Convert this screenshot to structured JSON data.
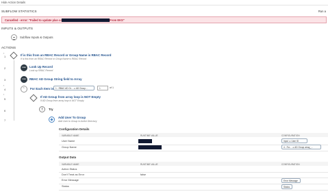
{
  "topbar": {
    "hide_link": "Hide Action Details"
  },
  "header": {
    "title": "SUBFLOW STATISTICS",
    "run_label": "Run a"
  },
  "alert": {
    "message_prefix": "Cancelled - error: \"Failed to update plan context: ",
    "message_suffix": " From EKS\""
  },
  "inputs_outputs": {
    "title": "INPUTS & OUTPUTS",
    "subflow_label": "Subflow Inputs & Outputs"
  },
  "actions": {
    "title": "ACTIONS",
    "steps": [
      {
        "num": "1",
        "title": "If is this from an RBAC Record or Group Name is RBAC Record",
        "subtitle": "If is this from an RBAC Record or Group Name is RBAC Record"
      },
      {
        "num": "2",
        "title": "Look Up Record",
        "subtitle": "Look up RBAC Record"
      },
      {
        "num": "3",
        "title": "RBAC AD Group String field to Array",
        "subtitle": ""
      },
      {
        "num": "4",
        "title": "For Each Item in",
        "pill": "1 - RBAC AD Gr... ➔ AD Group...",
        "counter": "1",
        "counter_of": "of 1"
      },
      {
        "num": "5",
        "title": "If AD Group from array loop is NOT Empty",
        "subtitle": "If AD Group from array loop is NOT Empty"
      },
      {
        "num": "6",
        "title": "Try",
        "subtitle": ""
      },
      {
        "num": "7",
        "title": "Add User To Group",
        "subtitle": "Add User to Group in Active Directory"
      }
    ]
  },
  "config_details": {
    "title": "Configuration Details",
    "headers": [
      "VARIABLE NAME",
      "RUNTIME VALUE",
      "CONFIGURATION"
    ],
    "rows": [
      {
        "name": "User Name",
        "config": "Input ➔ User ID"
      },
      {
        "name": "Group Name",
        "config": "4 - For... ➔ AD Group array_..."
      }
    ]
  },
  "output_data": {
    "title": "Output Data",
    "headers": [
      "VARIABLE NAME",
      "RUNTIME VALUE",
      "CONFIGURATION"
    ],
    "rows": [
      {
        "name": "Action Status",
        "value": "",
        "config": ""
      },
      {
        "name": "Don't Treat as Error",
        "value": "false",
        "config": ""
      },
      {
        "name": "Error Message",
        "value": "",
        "config": "Error Message"
      },
      {
        "name": "Status",
        "value": "",
        "config": "Status"
      }
    ]
  },
  "colors": {
    "link": "#1e4f8c",
    "alert_bg": "#fbe3e6",
    "alert_text": "#b3263b",
    "redaction": "#121a33"
  }
}
